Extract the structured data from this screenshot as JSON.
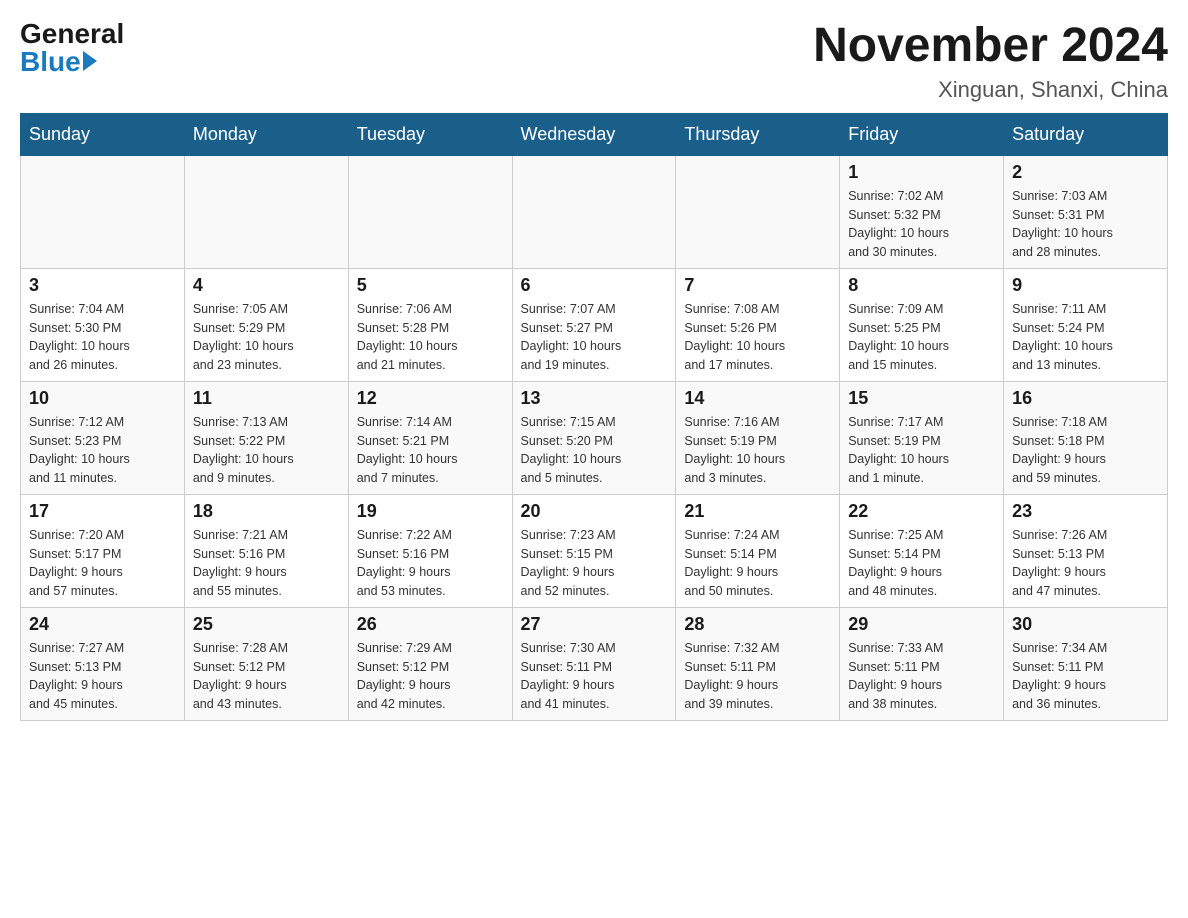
{
  "header": {
    "logo_general": "General",
    "logo_blue": "Blue",
    "month_title": "November 2024",
    "location": "Xinguan, Shanxi, China"
  },
  "weekdays": [
    "Sunday",
    "Monday",
    "Tuesday",
    "Wednesday",
    "Thursday",
    "Friday",
    "Saturday"
  ],
  "weeks": [
    [
      {
        "day": "",
        "info": ""
      },
      {
        "day": "",
        "info": ""
      },
      {
        "day": "",
        "info": ""
      },
      {
        "day": "",
        "info": ""
      },
      {
        "day": "",
        "info": ""
      },
      {
        "day": "1",
        "info": "Sunrise: 7:02 AM\nSunset: 5:32 PM\nDaylight: 10 hours\nand 30 minutes."
      },
      {
        "day": "2",
        "info": "Sunrise: 7:03 AM\nSunset: 5:31 PM\nDaylight: 10 hours\nand 28 minutes."
      }
    ],
    [
      {
        "day": "3",
        "info": "Sunrise: 7:04 AM\nSunset: 5:30 PM\nDaylight: 10 hours\nand 26 minutes."
      },
      {
        "day": "4",
        "info": "Sunrise: 7:05 AM\nSunset: 5:29 PM\nDaylight: 10 hours\nand 23 minutes."
      },
      {
        "day": "5",
        "info": "Sunrise: 7:06 AM\nSunset: 5:28 PM\nDaylight: 10 hours\nand 21 minutes."
      },
      {
        "day": "6",
        "info": "Sunrise: 7:07 AM\nSunset: 5:27 PM\nDaylight: 10 hours\nand 19 minutes."
      },
      {
        "day": "7",
        "info": "Sunrise: 7:08 AM\nSunset: 5:26 PM\nDaylight: 10 hours\nand 17 minutes."
      },
      {
        "day": "8",
        "info": "Sunrise: 7:09 AM\nSunset: 5:25 PM\nDaylight: 10 hours\nand 15 minutes."
      },
      {
        "day": "9",
        "info": "Sunrise: 7:11 AM\nSunset: 5:24 PM\nDaylight: 10 hours\nand 13 minutes."
      }
    ],
    [
      {
        "day": "10",
        "info": "Sunrise: 7:12 AM\nSunset: 5:23 PM\nDaylight: 10 hours\nand 11 minutes."
      },
      {
        "day": "11",
        "info": "Sunrise: 7:13 AM\nSunset: 5:22 PM\nDaylight: 10 hours\nand 9 minutes."
      },
      {
        "day": "12",
        "info": "Sunrise: 7:14 AM\nSunset: 5:21 PM\nDaylight: 10 hours\nand 7 minutes."
      },
      {
        "day": "13",
        "info": "Sunrise: 7:15 AM\nSunset: 5:20 PM\nDaylight: 10 hours\nand 5 minutes."
      },
      {
        "day": "14",
        "info": "Sunrise: 7:16 AM\nSunset: 5:19 PM\nDaylight: 10 hours\nand 3 minutes."
      },
      {
        "day": "15",
        "info": "Sunrise: 7:17 AM\nSunset: 5:19 PM\nDaylight: 10 hours\nand 1 minute."
      },
      {
        "day": "16",
        "info": "Sunrise: 7:18 AM\nSunset: 5:18 PM\nDaylight: 9 hours\nand 59 minutes."
      }
    ],
    [
      {
        "day": "17",
        "info": "Sunrise: 7:20 AM\nSunset: 5:17 PM\nDaylight: 9 hours\nand 57 minutes."
      },
      {
        "day": "18",
        "info": "Sunrise: 7:21 AM\nSunset: 5:16 PM\nDaylight: 9 hours\nand 55 minutes."
      },
      {
        "day": "19",
        "info": "Sunrise: 7:22 AM\nSunset: 5:16 PM\nDaylight: 9 hours\nand 53 minutes."
      },
      {
        "day": "20",
        "info": "Sunrise: 7:23 AM\nSunset: 5:15 PM\nDaylight: 9 hours\nand 52 minutes."
      },
      {
        "day": "21",
        "info": "Sunrise: 7:24 AM\nSunset: 5:14 PM\nDaylight: 9 hours\nand 50 minutes."
      },
      {
        "day": "22",
        "info": "Sunrise: 7:25 AM\nSunset: 5:14 PM\nDaylight: 9 hours\nand 48 minutes."
      },
      {
        "day": "23",
        "info": "Sunrise: 7:26 AM\nSunset: 5:13 PM\nDaylight: 9 hours\nand 47 minutes."
      }
    ],
    [
      {
        "day": "24",
        "info": "Sunrise: 7:27 AM\nSunset: 5:13 PM\nDaylight: 9 hours\nand 45 minutes."
      },
      {
        "day": "25",
        "info": "Sunrise: 7:28 AM\nSunset: 5:12 PM\nDaylight: 9 hours\nand 43 minutes."
      },
      {
        "day": "26",
        "info": "Sunrise: 7:29 AM\nSunset: 5:12 PM\nDaylight: 9 hours\nand 42 minutes."
      },
      {
        "day": "27",
        "info": "Sunrise: 7:30 AM\nSunset: 5:11 PM\nDaylight: 9 hours\nand 41 minutes."
      },
      {
        "day": "28",
        "info": "Sunrise: 7:32 AM\nSunset: 5:11 PM\nDaylight: 9 hours\nand 39 minutes."
      },
      {
        "day": "29",
        "info": "Sunrise: 7:33 AM\nSunset: 5:11 PM\nDaylight: 9 hours\nand 38 minutes."
      },
      {
        "day": "30",
        "info": "Sunrise: 7:34 AM\nSunset: 5:11 PM\nDaylight: 9 hours\nand 36 minutes."
      }
    ]
  ]
}
